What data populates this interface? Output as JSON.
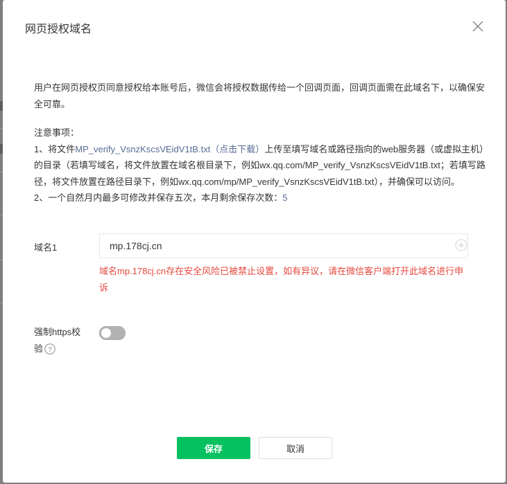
{
  "dialog": {
    "title": "网页授权域名",
    "intro": "用户在网页授权页同意授权给本账号后，微信会将授权数据传给一个回调页面，回调页面需在此域名下，以确保安全可靠。",
    "notes": {
      "heading": "注意事项：",
      "item1_prefix": "1、将文件",
      "file_link": "MP_verify_VsnzKscsVEidV1tB.txt（点击下载）",
      "item1_suffix": "上传至填写域名或路径指向的web服务器（或虚拟主机）的目录（若填写域名，将文件放置在域名根目录下，例如wx.qq.com/MP_verify_VsnzKscsVEidV1tB.txt；若填写路径，将文件放置在路径目录下，例如wx.qq.com/mp/MP_verify_VsnzKscsVEidV1tB.txt），并确保可以访问。",
      "item2_prefix": "2、一个自然月内最多可修改并保存五次，本月剩余保存次数：",
      "remaining_count": "5"
    },
    "domain_field": {
      "label": "域名1",
      "value": "mp.178cj.cn"
    },
    "error_text": "域名mp.178cj.cn存在安全风险已被禁止设置，如有异议，请在微信客户端打开此域名进行申诉",
    "https": {
      "label": "强制https校验",
      "enabled": false
    },
    "buttons": {
      "save": "保存",
      "cancel": "取消"
    },
    "icons": {
      "close": "close-icon",
      "add": "plus-circle-icon",
      "help": "question-circle-icon"
    },
    "colors": {
      "primary": "#07c160",
      "link": "#576b95",
      "error": "#e5483e"
    }
  }
}
